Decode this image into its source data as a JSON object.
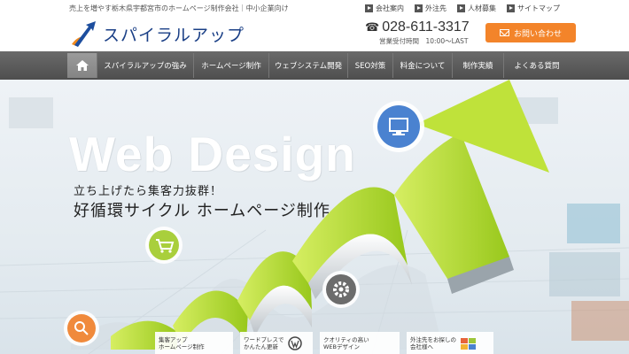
{
  "header": {
    "tagline": "売上を増やす栃木県宇都宮市のホームページ制作会社｜中小企業向け",
    "logo_text": "スパイラルアップ",
    "top_links": [
      {
        "label": "会社案内"
      },
      {
        "label": "外注先"
      },
      {
        "label": "人材募集"
      },
      {
        "label": "サイトマップ"
      }
    ],
    "phone": "028-611-3317",
    "hours": "営業受付時間　10:00～LAST",
    "contact_label": "お問い合わせ"
  },
  "nav": {
    "items": [
      {
        "label": "スパイラルアップの強み"
      },
      {
        "label": "ホームページ制作"
      },
      {
        "label": "ウェブシステム開発"
      },
      {
        "label": "SEO対策"
      },
      {
        "label": "料金について"
      },
      {
        "label": "制作実績"
      },
      {
        "label": "よくある質問"
      }
    ]
  },
  "hero": {
    "big_text": "Web Design",
    "catch_line1": "立ち上げたら集客力抜群！",
    "catch_line2": "好循環サイクル ホームページ制作",
    "circle_icons": [
      "monitor-icon",
      "cart-icon",
      "gear-icon",
      "search-icon"
    ],
    "bottom_items": [
      {
        "line1": "集客アップ",
        "line2": "ホームページ制作"
      },
      {
        "line1": "ワードプレスで",
        "line2": "かんたん更新"
      },
      {
        "line1": "クオリティの高い",
        "line2": "WEBデザイン"
      },
      {
        "line1": "外注先をお探しの",
        "line2": "会社様へ"
      }
    ]
  },
  "colors": {
    "accent": "#f3842a",
    "nav_bg": "#5c5c5c",
    "arrow": "#b8dd2a",
    "logo_blue": "#1a3f86"
  }
}
